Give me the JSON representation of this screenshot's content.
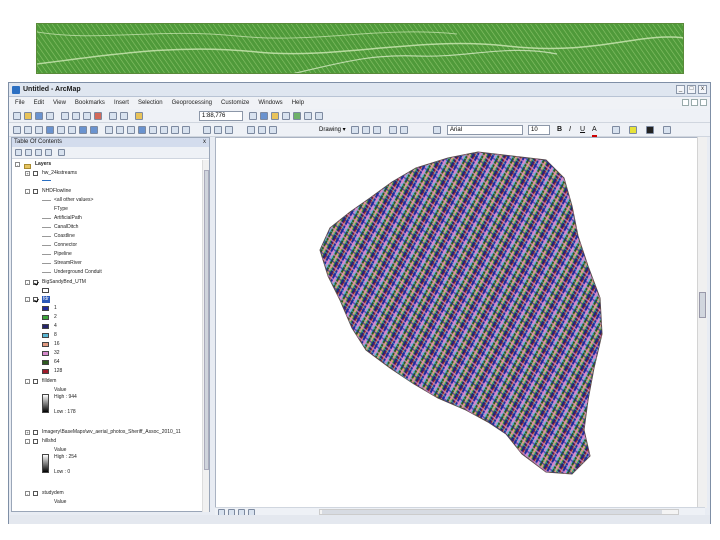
{
  "window": {
    "title": "Untitled - ArcMap",
    "controls": [
      "_",
      "□",
      "x"
    ]
  },
  "menu": [
    "File",
    "Edit",
    "View",
    "Bookmarks",
    "Insert",
    "Selection",
    "Geoprocessing",
    "Customize",
    "Windows",
    "Help"
  ],
  "toolbar": {
    "scale": "1:88,776",
    "drawing_label": "Drawing ▾",
    "font_name": "Arial",
    "font_size": "10",
    "bold": "B",
    "italic": "I",
    "underline": "U",
    "font_color": "A"
  },
  "toc": {
    "title": "Table Of Contents",
    "close": "x",
    "items": [
      {
        "label": "Layers"
      },
      {
        "label": "hw_24kstreams"
      },
      {
        "label": "NHDFlowline"
      },
      {
        "label": "<all other values>"
      },
      {
        "label": "FType"
      },
      {
        "label": "ArtificialPath"
      },
      {
        "label": "CanalDitch"
      },
      {
        "label": "Coastline"
      },
      {
        "label": "Connector"
      },
      {
        "label": "Pipeline"
      },
      {
        "label": "StreamRiver"
      },
      {
        "label": "Underground Conduit"
      },
      {
        "label": "BigSandyBnd_UTM"
      },
      {
        "label": "fdr"
      },
      {
        "label": "1"
      },
      {
        "label": "2"
      },
      {
        "label": "4"
      },
      {
        "label": "8"
      },
      {
        "label": "16"
      },
      {
        "label": "32"
      },
      {
        "label": "64"
      },
      {
        "label": "128"
      },
      {
        "label": "filldem"
      },
      {
        "label": "Value"
      },
      {
        "label": "High : 944"
      },
      {
        "label": "Low : 178"
      },
      {
        "label": "Imagery\\BaseMaps\\wv_aerial_photos_Sheriff_Assoc_2010_11"
      },
      {
        "label": "hillshd"
      },
      {
        "label": "Value"
      },
      {
        "label": "High : 254"
      },
      {
        "label": "Low : 0"
      },
      {
        "label": "studydem"
      },
      {
        "label": "Value"
      }
    ]
  },
  "colors": {
    "fdr_1": "#1f2a9e",
    "fdr_2": "#3da53a",
    "fdr_4": "#24246a",
    "fdr_8": "#5ab7d4",
    "fdr_16": "#e09a80",
    "fdr_32": "#d68acb",
    "fdr_64": "#2d5a1f",
    "fdr_128": "#a01a2a",
    "banner_green": "#4f9a3a"
  }
}
